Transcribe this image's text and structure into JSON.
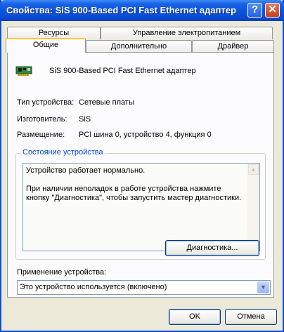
{
  "window": {
    "title": "Свойства: SiS 900-Based PCI Fast Ethernet адаптер",
    "help_label": "?",
    "close_label": "✕"
  },
  "tabs": {
    "row_back": [
      "Ресурсы",
      "Управление электропитанием"
    ],
    "row_front": [
      "Общие",
      "Дополнительно",
      "Драйвер"
    ],
    "active": "Общие"
  },
  "device": {
    "icon": "network-card-icon",
    "name": "SiS 900-Based PCI Fast Ethernet адаптер",
    "type_label": "Тип устройства:",
    "type_value": "Сетевые платы",
    "manufacturer_label": "Изготовитель:",
    "manufacturer_value": "SiS",
    "location_label": "Размещение:",
    "location_value": "PCI шина 0, устройство 4, функция 0"
  },
  "status": {
    "group_title": "Состояние устройства",
    "line1": "Устройство работает нормально.",
    "line2": "При наличии неполадок в работе устройства нажмите кнопку \"Диагностика\", чтобы запустить мастер диагностики.",
    "troubleshoot_label": "Диагностика..."
  },
  "usage": {
    "label": "Применение устройства:",
    "value": "Это устройство используется (включено)"
  },
  "footer": {
    "ok_label": "OK",
    "cancel_label": "Отмена"
  },
  "colors": {
    "title_bar": "#0a4bd2",
    "active_tab_accent": "#ffc83c",
    "group_title": "#0046d5"
  }
}
